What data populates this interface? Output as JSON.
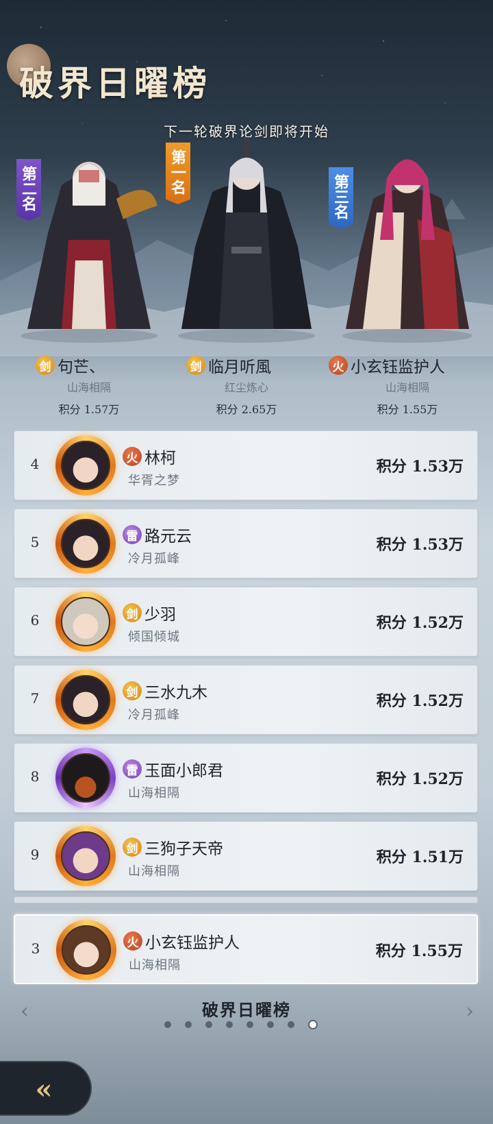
{
  "header": {
    "title": "破界日曜榜",
    "subtitle": "下一轮破界论剑即将开始"
  },
  "podium": [
    {
      "rank_label": "第二名",
      "name": "句芒、",
      "element": "剑",
      "server": "山海相隔",
      "score": "积分 1.57万"
    },
    {
      "rank_label": "第一名",
      "name": "临月听風",
      "element": "剑",
      "server": "红尘炼心",
      "score": "积分 2.65万"
    },
    {
      "rank_label": "第三名",
      "name": "小玄钰监护人",
      "element": "火",
      "server": "山海相隔",
      "score": "积分 1.55万"
    }
  ],
  "rows": [
    {
      "rank": "4",
      "element": "火",
      "name": "林柯",
      "server": "华胥之梦",
      "score": "积分 1.53万"
    },
    {
      "rank": "5",
      "element": "雷",
      "name": "路元云",
      "server": "冷月孤峰",
      "score": "积分 1.53万"
    },
    {
      "rank": "6",
      "element": "剑",
      "name": "少羽",
      "server": "倾国倾城",
      "score": "积分 1.52万"
    },
    {
      "rank": "7",
      "element": "剑",
      "name": "三水九木",
      "server": "冷月孤峰",
      "score": "积分 1.52万"
    },
    {
      "rank": "8",
      "element": "雷",
      "name": "玉面小郎君",
      "server": "山海相隔",
      "score": "积分 1.52万"
    },
    {
      "rank": "9",
      "element": "剑",
      "name": "三狗子天帝",
      "server": "山海相隔",
      "score": "积分 1.51万"
    }
  ],
  "self_row": {
    "rank": "3",
    "element": "火",
    "name": "小玄钰监护人",
    "server": "山海相隔",
    "score": "积分 1.55万"
  },
  "footer": {
    "title": "破界日曜榜",
    "page_count": 8,
    "active_page": 8,
    "left_arrow": "‹",
    "right_arrow": "›",
    "back_icon": "«"
  },
  "icons": {
    "back": "back-arrow-icon",
    "prev": "chevron-left-icon",
    "next": "chevron-right-icon"
  }
}
